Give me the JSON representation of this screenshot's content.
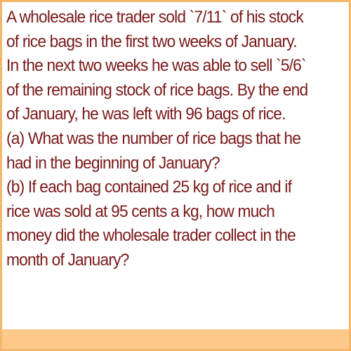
{
  "problem": {
    "lines": [
      "A wholesale rice trader sold `7/11` of his stock",
      "of rice bags in the first two weeks of January.",
      "In the next two weeks he was able to sell `5/6`",
      "of the remaining stock of rice bags. By the end",
      "of January, he was left with 96 bags of rice.",
      " (a) What was the number of rice bags that he",
      "had in the beginning of January?",
      " (b) If each bag contained 25 kg of rice and if",
      "rice was sold at 95 cents a kg, how much",
      "money did the wholesale trader collect in the",
      "month of January?"
    ]
  },
  "colors": {
    "text": "#7a1a1a",
    "border": "#f5b66a",
    "band": "#fcc98b",
    "background": "#ffffff"
  }
}
